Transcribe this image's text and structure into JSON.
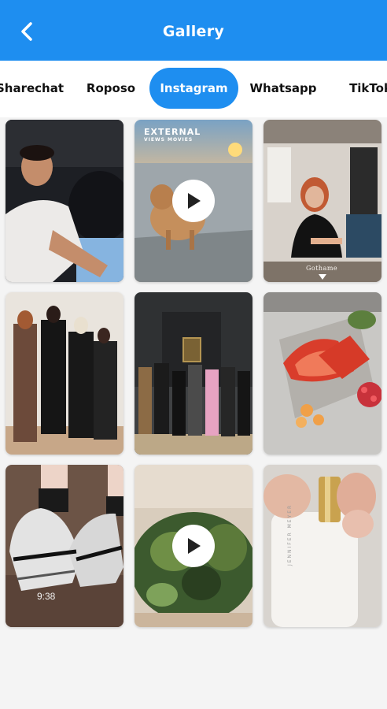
{
  "header": {
    "title": "Gallery"
  },
  "tabs": [
    {
      "label": "Sharechat",
      "active": false
    },
    {
      "label": "Roposo",
      "active": false
    },
    {
      "label": "Instagram",
      "active": true
    },
    {
      "label": "Whatsapp",
      "active": false
    },
    {
      "label": "TikTok",
      "active": false
    }
  ],
  "gallery": {
    "items": [
      {
        "kind": "image"
      },
      {
        "kind": "video",
        "overlay_text_1": "EXTERNAL",
        "overlay_text_2": "VIEWS MOVIES"
      },
      {
        "kind": "image",
        "caption": "Gothame"
      },
      {
        "kind": "image"
      },
      {
        "kind": "image"
      },
      {
        "kind": "image"
      },
      {
        "kind": "image",
        "time": "9:38"
      },
      {
        "kind": "video"
      },
      {
        "kind": "image",
        "brand": "JENNIFER MEYER"
      }
    ]
  },
  "colors": {
    "accent": "#1e8ef0",
    "background": "#f4f4f4"
  }
}
